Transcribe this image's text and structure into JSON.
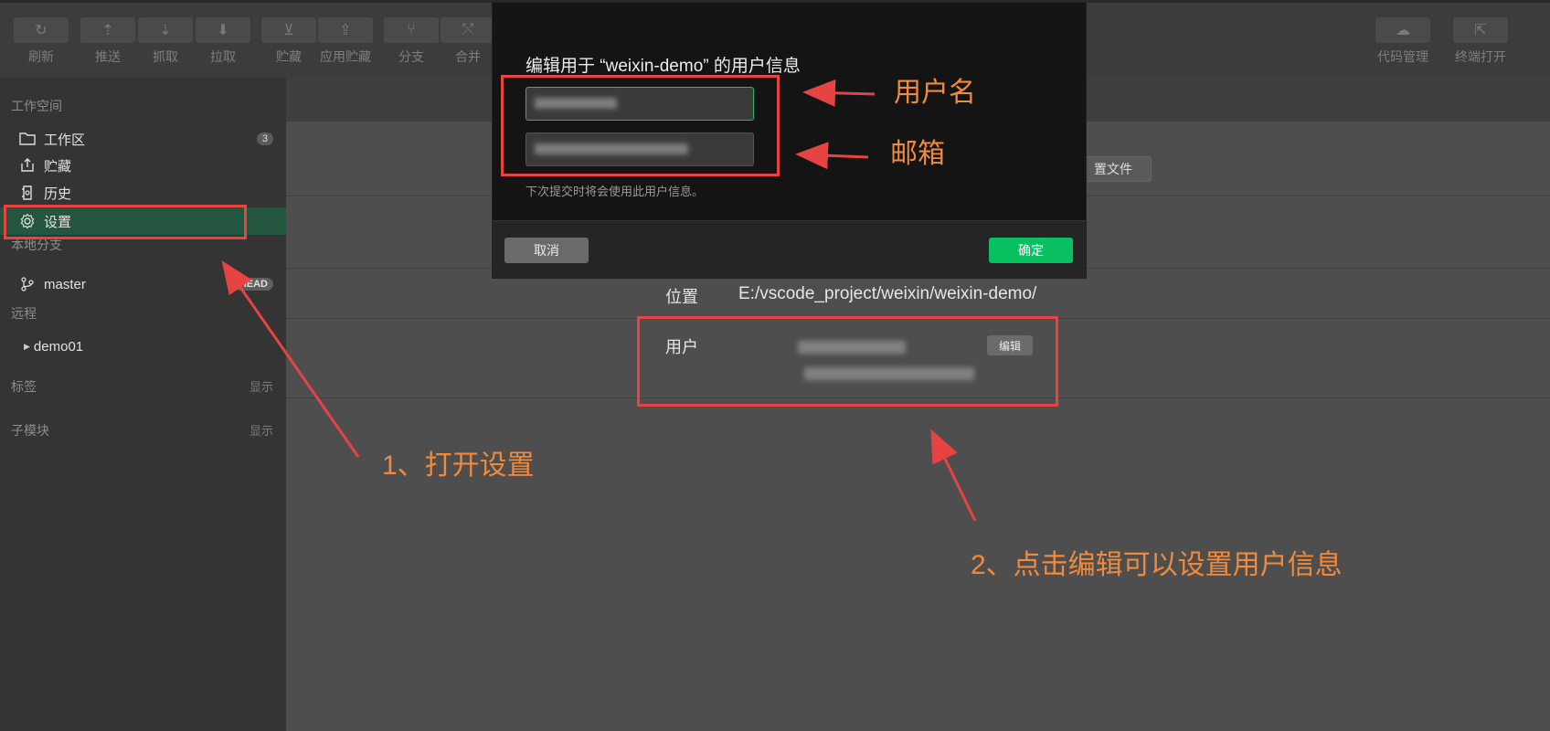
{
  "toolbar": {
    "items": [
      {
        "label": "刷新",
        "icon": "refresh-icon",
        "glyph": "↻"
      },
      {
        "label": "推送",
        "icon": "push-icon",
        "glyph": "⇡"
      },
      {
        "label": "抓取",
        "icon": "fetch-icon",
        "glyph": "⇣"
      },
      {
        "label": "拉取",
        "icon": "pull-icon",
        "glyph": "⬇"
      },
      {
        "label": "贮藏",
        "icon": "stash-icon",
        "glyph": "⊻"
      },
      {
        "label": "应用贮藏",
        "icon": "apply-stash-icon",
        "glyph": "⇪"
      },
      {
        "label": "分支",
        "icon": "branch-icon",
        "glyph": "⑂"
      },
      {
        "label": "合并",
        "icon": "merge-icon",
        "glyph": "⤲"
      }
    ],
    "right_items": [
      {
        "label": "代码管理",
        "icon": "cloud-icon",
        "glyph": "☁"
      },
      {
        "label": "终端打开",
        "icon": "external-open-icon",
        "glyph": "⇱"
      }
    ]
  },
  "sidebar": {
    "workspace_title": "工作空间",
    "workspace_items": [
      {
        "label": "工作区",
        "icon": "folder-icon",
        "badge": "3"
      },
      {
        "label": "贮藏",
        "icon": "stash-icon"
      },
      {
        "label": "历史",
        "icon": "history-icon"
      },
      {
        "label": "设置",
        "icon": "gear-icon",
        "active": true
      }
    ],
    "local_branches_title": "本地分支",
    "branch": {
      "label": "master",
      "badge": "HEAD"
    },
    "remote_title": "远程",
    "remote_item": "demo01",
    "tags_title": "标签",
    "tags_action": "显示",
    "submodules_title": "子模块",
    "submodules_action": "显示"
  },
  "main": {
    "config_file_button": "置文件",
    "location_label": "位置",
    "location_value": "E:/vscode_project/weixin/weixin-demo/",
    "user_label": "用户",
    "edit_button": "编辑"
  },
  "modal": {
    "title": "编辑用于 “weixin-demo” 的用户信息",
    "username_value": "",
    "email_value": "",
    "hint": "下次提交时将会使用此用户信息。",
    "cancel_label": "取消",
    "ok_label": "确定"
  },
  "annotations": {
    "username": "用户名",
    "email": "邮箱",
    "step1": "1、打开设置",
    "step2": "2、点击编辑可以设置用户信息"
  },
  "colors": {
    "accent": "#07c160",
    "active_bg": "#24563f",
    "annotation": "#f08a3c",
    "annotation_box": "#e84343"
  }
}
